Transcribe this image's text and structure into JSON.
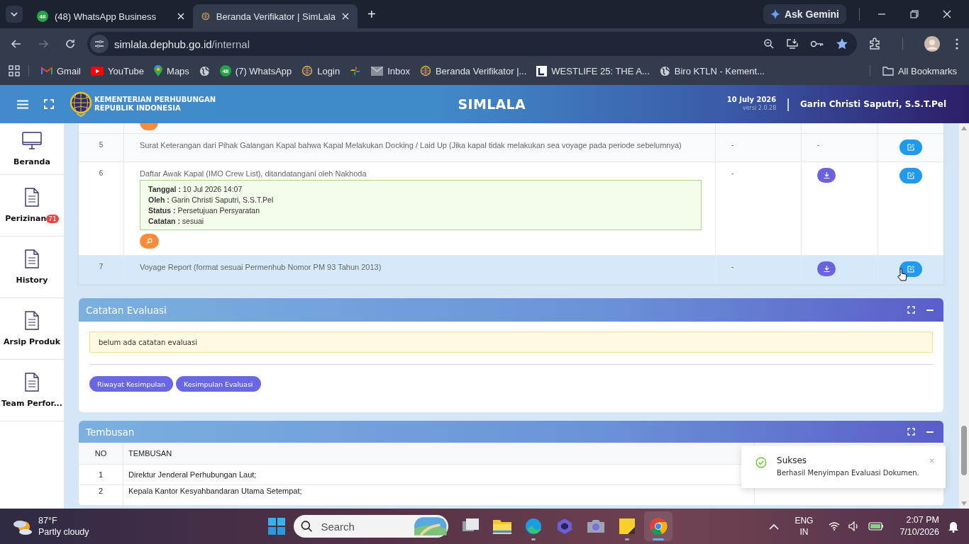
{
  "browser": {
    "tabs": [
      {
        "title": "(48) WhatsApp Business",
        "badge": "48",
        "kind": "whatsapp",
        "selected": false
      },
      {
        "title": "Beranda Verifikator | SimLala",
        "kind": "globe-logo",
        "selected": true
      }
    ],
    "new_tab": "+",
    "ask_gemini": "Ask Gemini",
    "url_host": "simlala.dephub.go.id",
    "url_path": "/internal",
    "bookmarks": [
      {
        "label": "Gmail",
        "kind": "gmail"
      },
      {
        "label": "YouTube",
        "kind": "youtube"
      },
      {
        "label": "Maps",
        "kind": "maps"
      },
      {
        "kind": "globe"
      },
      {
        "label": "(7) WhatsApp",
        "kind": "whatsapp",
        "badge": "48"
      },
      {
        "label": "Login",
        "kind": "globe-logo"
      },
      {
        "kind": "pinwheel"
      },
      {
        "label": "Inbox",
        "kind": "mail"
      },
      {
        "label": "Beranda Verifikator |...",
        "kind": "globe-logo"
      },
      {
        "label": "WESTLIFE 25: THE A...",
        "kind": "letter"
      },
      {
        "label": "Biro KTLN - Kement...",
        "kind": "globe"
      }
    ],
    "all_bookmarks": "All Bookmarks"
  },
  "header": {
    "org_line1": "KEMENTERIAN PERHUBUNGAN",
    "org_line2": "REPUBLIK INDONESIA",
    "app_name": "SIMLALA",
    "date": "10 July 2026",
    "version": "versi 2.0.28",
    "separator": "|",
    "user": "Garin Christi Saputri, S.S.T.Pel"
  },
  "sidebar": {
    "items": [
      {
        "label": "Beranda",
        "kind": "monitor"
      },
      {
        "label": "Perizinan",
        "kind": "document",
        "badge": "71"
      },
      {
        "label": "History",
        "kind": "document"
      },
      {
        "label": "Arsip Produk",
        "kind": "document"
      },
      {
        "label": "Team Perfor...",
        "kind": "document"
      }
    ]
  },
  "documents": {
    "rows": [
      {
        "kind": "cut"
      },
      {
        "kind": "row",
        "no": "5",
        "title": "Surat Keterangan dari Pihak Galangan Kapal bahwa Kapal Melakukan Docking / Laid Up (Jika kapal tidak melakukan sea voyage pada periode sebelumnya)",
        "column_3": "-",
        "download": false,
        "column_4": "-",
        "highlighted": false
      },
      {
        "kind": "row",
        "no": "6",
        "title": "Daftar Awak Kapal (IMO Crew List), ditandatangani oleh Nakhoda",
        "column_3": "-",
        "download": true,
        "highlighted": false,
        "evaluation": [
          {
            "label": "Tanggal :",
            "value": "10 Jul 2026 14:07"
          },
          {
            "label": "Oleh :",
            "value": "Garin Christi Saputri, S.S.T.Pel"
          },
          {
            "label": "Status :",
            "value": "Persetujuan Persyaratan"
          },
          {
            "label": "Catatan :",
            "value": "sesuai"
          }
        ]
      },
      {
        "kind": "row",
        "no": "7",
        "title": "Voyage Report (format sesuai Permenhub Nomor PM 93 Tahun 2013)",
        "column_3": "-",
        "download": true,
        "highlighted": true
      }
    ]
  },
  "evaluation_card": {
    "title": "Catatan Evaluasi",
    "note": "belum ada catatan evaluasi",
    "buttons": [
      "Riwayat Kesimpulan",
      "Kesimpulan Evaluasi"
    ]
  },
  "tembusan": {
    "title": "Tembusan",
    "columns": [
      "NO",
      "TEMBUSAN"
    ],
    "rows": [
      {
        "no": "1",
        "text": "Direktur Jenderal Perhubungan Laut;"
      },
      {
        "no": "2",
        "text": "Kepala Kantor Kesyahbandaran Utama Setempat;"
      }
    ]
  },
  "toast": {
    "title": "Sukses",
    "message": "Berhasil Menyimpan Evaluasi Dokumen."
  },
  "taskbar": {
    "temperature": "87°F",
    "weather": "Partly cloudy",
    "search_placeholder": "Search",
    "apps": [
      {
        "kind": "task-view",
        "running": false,
        "active": false
      },
      {
        "kind": "folder",
        "running": false,
        "active": false
      },
      {
        "kind": "edge",
        "running": true,
        "active": false
      },
      {
        "kind": "copilot",
        "running": false,
        "active": false
      },
      {
        "kind": "camera",
        "running": false,
        "active": false
      },
      {
        "kind": "notes",
        "running": true,
        "active": false
      },
      {
        "kind": "chrome",
        "running": true,
        "active": true
      }
    ],
    "language": "ENG",
    "region": "IN",
    "time": "2:07 PM",
    "date": "7/10/2026"
  }
}
